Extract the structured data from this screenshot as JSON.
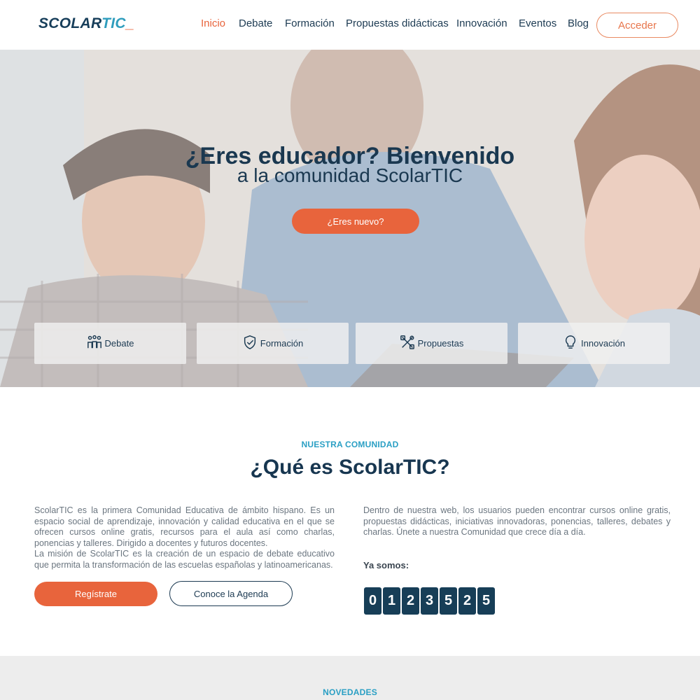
{
  "header": {
    "logo": {
      "part1": "SCOLAR",
      "part2": "TIC",
      "part3": "_"
    },
    "nav": [
      "Inicio",
      "Debate",
      "Formación",
      "Propuestas didácticas",
      "Innovación",
      "Eventos",
      "Blog"
    ],
    "active_nav": "Inicio",
    "login_label": "Acceder"
  },
  "hero": {
    "title": "¿Eres educador? Bienvenido",
    "subtitle": "a la comunidad ScolarTIC",
    "cta_label": "¿Eres nuevo?",
    "categories": [
      {
        "label": "Debate",
        "icon": "people-icon"
      },
      {
        "label": "Formación",
        "icon": "shield-check-icon"
      },
      {
        "label": "Propuestas",
        "icon": "tools-icon"
      },
      {
        "label": "Innovación",
        "icon": "lightbulb-icon"
      }
    ]
  },
  "community": {
    "eyebrow": "NUESTRA COMUNIDAD",
    "title": "¿Qué es ScolarTIC?",
    "left_text": "ScolarTIC  es la primera Comunidad Educativa de ámbito hispano. Es un espacio social de aprendizaje, innovación y calidad educativa en el que se ofrecen cursos online gratis, recursos para el aula así como charlas, ponencias y talleres. Dirigido a docentes y futuros docentes.",
    "left_text_2": "La misión de ScolarTIC es la creación de un espacio de debate educativo que permita la transformación de las escuelas españolas y latinoamericanas.",
    "right_text": "Dentro de nuestra web, los usuarios pueden encontrar cursos online gratis, propuestas didácticas, iniciativas innovadoras, ponencias, talleres, debates y charlas. Únete a nuestra Comunidad que crece día a día.",
    "register_label": "Regístrate",
    "agenda_label": "Conoce la Agenda",
    "counter_label": "Ya somos:",
    "counter_digits": [
      "0",
      "1",
      "2",
      "3",
      "5",
      "2",
      "5"
    ]
  },
  "news": {
    "eyebrow": "NOVEDADES"
  },
  "colors": {
    "accent": "#e8643c",
    "primary": "#173e57",
    "teal": "#2a9fc4"
  }
}
